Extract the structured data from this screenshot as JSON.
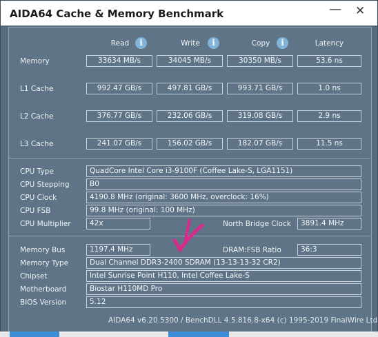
{
  "window": {
    "title": "AIDA64 Cache & Memory Benchmark",
    "minimize": "—",
    "close": "✕"
  },
  "columns": {
    "read": "Read",
    "write": "Write",
    "copy": "Copy",
    "latency": "Latency"
  },
  "rows": [
    {
      "label": "Memory",
      "read": "33634 MB/s",
      "write": "34045 MB/s",
      "copy": "30350 MB/s",
      "latency": "53.6 ns"
    },
    {
      "label": "L1 Cache",
      "read": "992.47 GB/s",
      "write": "497.81 GB/s",
      "copy": "993.71 GB/s",
      "latency": "1.0 ns"
    },
    {
      "label": "L2 Cache",
      "read": "376.77 GB/s",
      "write": "232.06 GB/s",
      "copy": "319.08 GB/s",
      "latency": "2.9 ns"
    },
    {
      "label": "L3 Cache",
      "read": "241.07 GB/s",
      "write": "156.02 GB/s",
      "copy": "182.07 GB/s",
      "latency": "11.5 ns"
    }
  ],
  "cpu": {
    "type_label": "CPU Type",
    "type": "QuadCore Intel Core i3-9100F  (Coffee Lake-S, LGA1151)",
    "stepping_label": "CPU Stepping",
    "stepping": "B0",
    "clock_label": "CPU Clock",
    "clock": "4190.8 MHz  (original: 3600 MHz, overclock: 16%)",
    "fsb_label": "CPU FSB",
    "fsb": "99.8 MHz  (original: 100 MHz)",
    "multiplier_label": "CPU Multiplier",
    "multiplier": "42x",
    "nb_clock_label": "North Bridge Clock",
    "nb_clock": "3891.4 MHz"
  },
  "memory": {
    "bus_label": "Memory Bus",
    "bus": "1197.4 MHz",
    "ratio_label": "DRAM:FSB Ratio",
    "ratio": "36:3",
    "type_label": "Memory Type",
    "type": "Dual Channel DDR3-2400 SDRAM  (13-13-13-32 CR2)",
    "chipset_label": "Chipset",
    "chipset": "Intel Sunrise Point H110, Intel Coffee Lake-S",
    "motherboard_label": "Motherboard",
    "motherboard": "Biostar H110MD Pro",
    "bios_label": "BIOS Version",
    "bios": "5.12"
  },
  "footer": "AIDA64 v6.20.5300 / BenchDLL 4.5.816.8-x64  (c) 1995-2019 FinalWire Ltd.",
  "annotation": {
    "color": "#d92a8c",
    "icon": "checkmark-annotation"
  },
  "colors": {
    "background": "#566d80",
    "panel": "#5f7587",
    "info": "#82b4d9",
    "accent_tab": "#3d8ed6"
  }
}
